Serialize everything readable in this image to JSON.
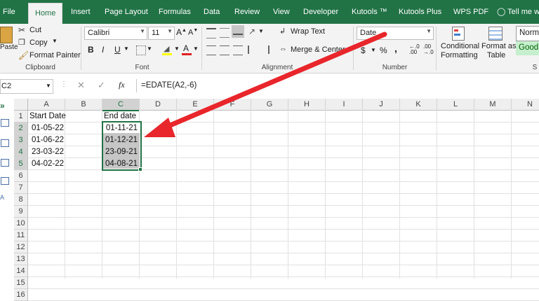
{
  "tabs": [
    {
      "label": "File",
      "active": false
    },
    {
      "label": "Home",
      "active": true
    },
    {
      "label": "Insert",
      "active": false
    },
    {
      "label": "Page Layout",
      "active": false
    },
    {
      "label": "Formulas",
      "active": false
    },
    {
      "label": "Data",
      "active": false
    },
    {
      "label": "Review",
      "active": false
    },
    {
      "label": "View",
      "active": false
    },
    {
      "label": "Developer",
      "active": false
    },
    {
      "label": "Kutools ™",
      "active": false
    },
    {
      "label": "Kutools Plus",
      "active": false
    },
    {
      "label": "WPS PDF",
      "active": false
    }
  ],
  "tell_me": "Tell me wh",
  "clipboard": {
    "paste": "Paste",
    "cut": "Cut",
    "copy": "Copy",
    "format_painter": "Format Painter",
    "label": "Clipboard"
  },
  "font": {
    "name": "Calibri",
    "size": "11",
    "label": "Font",
    "bold": "B",
    "italic": "I",
    "underline": "U"
  },
  "alignment": {
    "wrap": "Wrap Text",
    "merge": "Merge & Center",
    "label": "Alignment"
  },
  "number": {
    "format": "Date",
    "currency": "$",
    "percent": "%",
    "comma": ",",
    "label": "Number"
  },
  "styles": {
    "conditional_1": "Conditional",
    "conditional_2": "Formatting",
    "format_as_1": "Format as",
    "format_as_2": "Table",
    "normal": "Norm",
    "good": "Good",
    "label": "S"
  },
  "formula_bar": {
    "name_box": "C2",
    "fx": "fx",
    "formula": "=EDATE(A2,-6)"
  },
  "columns": [
    "A",
    "B",
    "C",
    "D",
    "E",
    "F",
    "G",
    "H",
    "I",
    "J",
    "K",
    "L",
    "M",
    "N"
  ],
  "rows": [
    "1",
    "2",
    "3",
    "4",
    "5",
    "6",
    "7",
    "8",
    "9",
    "10",
    "11",
    "12",
    "13",
    "14",
    "15",
    "16"
  ],
  "cells": {
    "A1": "Start Date",
    "C1": "End date",
    "A2": "01-05-22",
    "C2": "01-11-21",
    "A3": "01-06-22",
    "C3": "01-12-21",
    "A4": "23-03-22",
    "C4": "23-09-21",
    "A5": "04-02-22",
    "C5": "04-08-21"
  },
  "colors": {
    "excel_green": "#217346",
    "arrow": "#e8262b",
    "selection": "#c6c6c6"
  }
}
